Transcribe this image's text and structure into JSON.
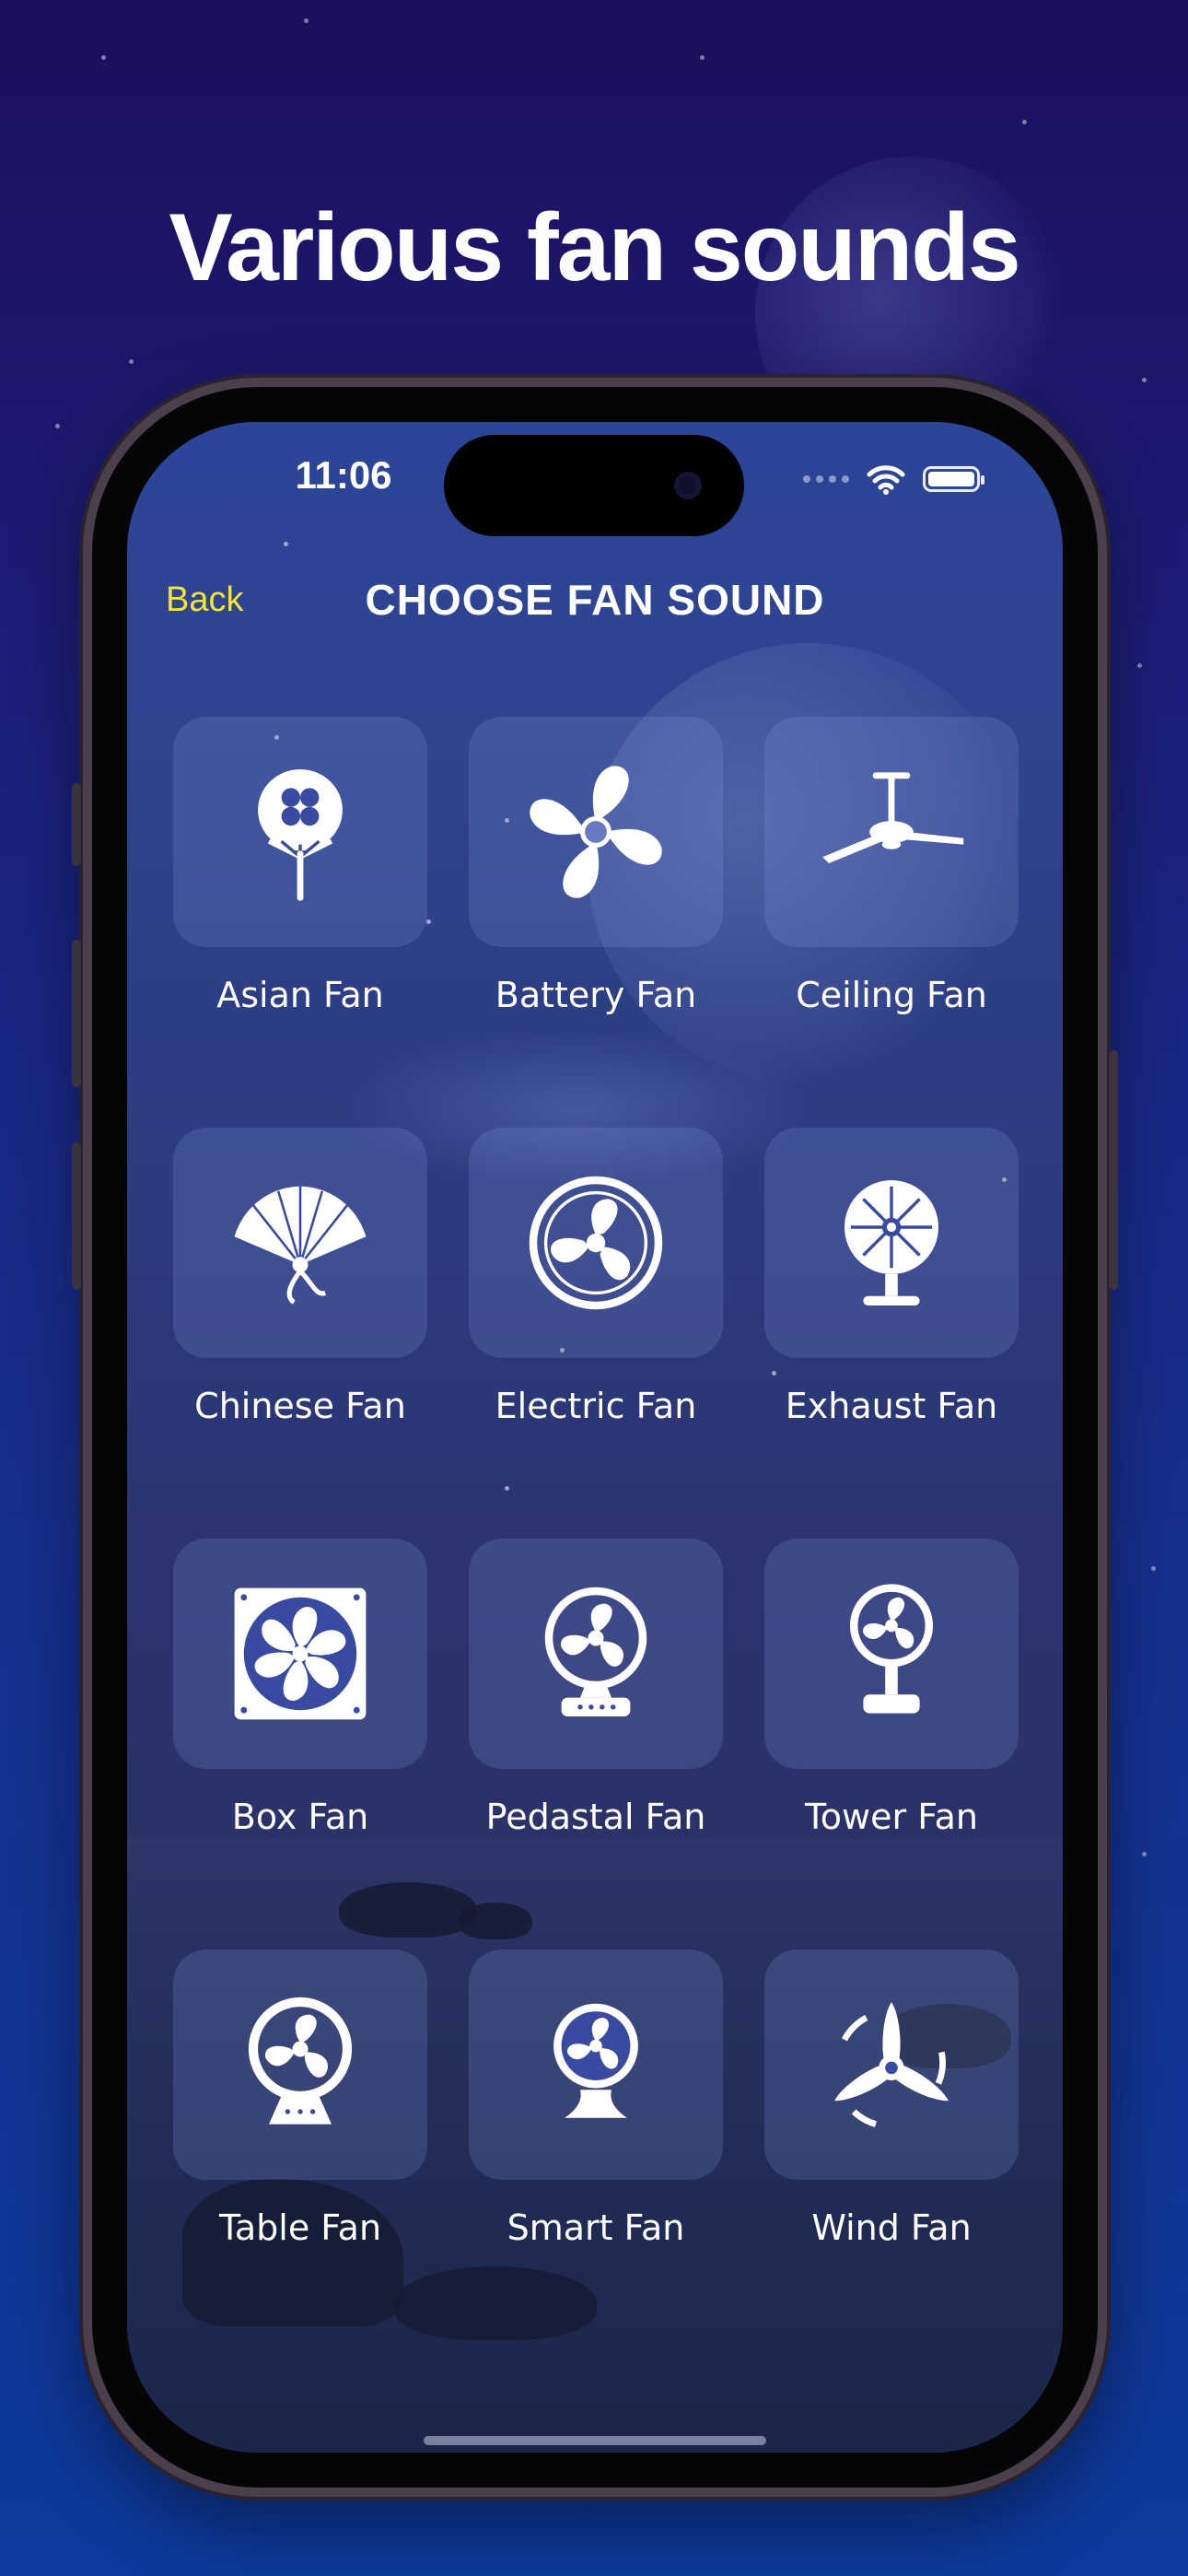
{
  "headline": "Various fan sounds",
  "status_bar": {
    "time": "11:06"
  },
  "nav": {
    "back_label": "Back",
    "title": "CHOOSE FAN SOUND"
  },
  "fans": [
    {
      "label": "Asian Fan",
      "icon": "asian-fan-icon"
    },
    {
      "label": "Battery Fan",
      "icon": "battery-fan-icon"
    },
    {
      "label": "Ceiling Fan",
      "icon": "ceiling-fan-icon"
    },
    {
      "label": "Chinese Fan",
      "icon": "chinese-fan-icon"
    },
    {
      "label": "Electric Fan",
      "icon": "electric-fan-icon"
    },
    {
      "label": "Exhaust Fan",
      "icon": "exhaust-fan-icon"
    },
    {
      "label": "Box Fan",
      "icon": "box-fan-icon"
    },
    {
      "label": "Pedastal Fan",
      "icon": "pedastal-fan-icon"
    },
    {
      "label": "Tower Fan",
      "icon": "tower-fan-icon"
    },
    {
      "label": "Table Fan",
      "icon": "table-fan-icon"
    },
    {
      "label": "Smart Fan",
      "icon": "smart-fan-icon"
    },
    {
      "label": "Wind Fan",
      "icon": "wind-fan-icon"
    }
  ],
  "colors": {
    "back_accent": "#f2e534",
    "tile_bg": "rgba(140,160,230,0.20)",
    "text": "#ffffff"
  }
}
